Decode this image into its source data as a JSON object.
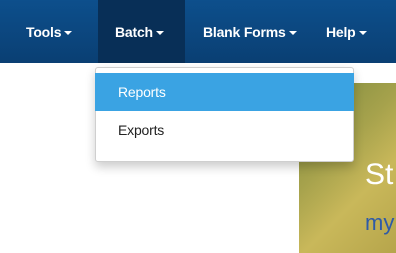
{
  "navbar": {
    "items": [
      {
        "label": "Tools"
      },
      {
        "label": "Batch"
      },
      {
        "label": "Blank Forms"
      },
      {
        "label": "Help"
      }
    ]
  },
  "dropdown": {
    "items": [
      {
        "label": "Reports",
        "state": "highlighted"
      },
      {
        "label": "Exports"
      }
    ]
  },
  "hero": {
    "line1": "St",
    "line2": "my"
  },
  "colors": {
    "navbar": "#0d4f8c",
    "navbar_active": "#082f57",
    "menu_highlight": "#3aa3e3"
  }
}
